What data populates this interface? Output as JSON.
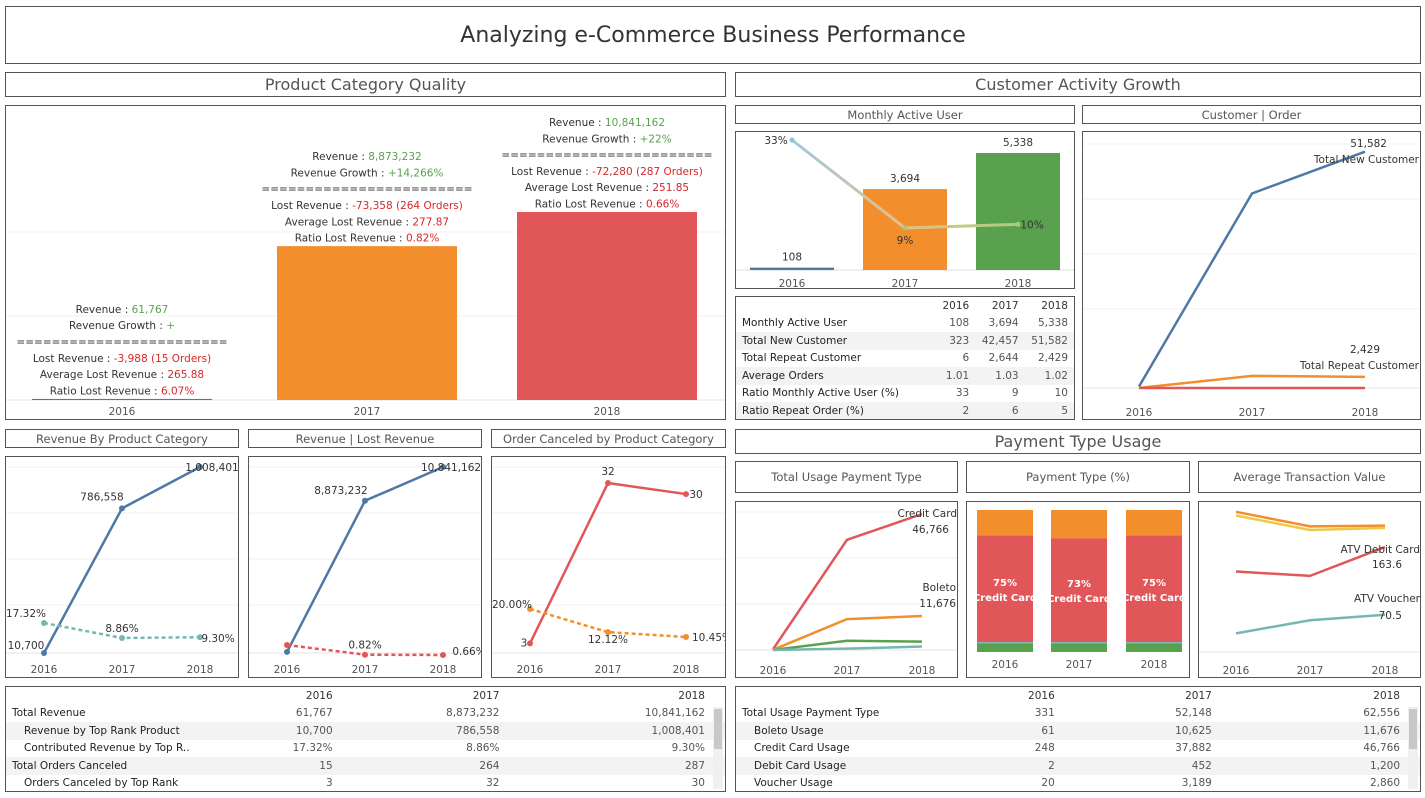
{
  "page_title": "Analyzing e-Commerce Business Performance",
  "sections": {
    "product": "Product Category Quality",
    "customer": "Customer Activity Growth",
    "payment": "Payment Type Usage"
  },
  "subtitles": {
    "mau": "Monthly Active User",
    "cust_order": "Customer | Order",
    "rev_cat": "Revenue By Product Category",
    "rev_lost": "Revenue | Lost Revenue",
    "cancel_cat": "Order Canceled by Product Category",
    "total_usage": "Total Usage Payment Type",
    "pay_pct": "Payment Type (%)",
    "atv": "Average Transaction Value"
  },
  "colors": {
    "blue": "#4e79a7",
    "orange": "#f28e2b",
    "red": "#e15759",
    "green": "#59a14f",
    "teal": "#76b7b2",
    "yellow": "#edc948",
    "light_blue": "#8cc5e0",
    "pos": "#59a14f",
    "neg": "#d62728"
  },
  "chart_data": [
    {
      "id": "product_quality",
      "type": "bar",
      "categories": [
        "2016",
        "2017",
        "2018"
      ],
      "values": [
        61767,
        8873232,
        10841162
      ],
      "bar_colors": [
        "#4e79a7",
        "#f28e2b",
        "#e15759"
      ],
      "annotations": [
        {
          "revenue": "61,767",
          "growth": "+",
          "sep": "========================",
          "lost": "-3,988 (15 Orders)",
          "avg_lost": "265.88",
          "ratio": "6.07%"
        },
        {
          "revenue": "8,873,232",
          "growth": "+14,266%",
          "sep": "========================",
          "lost": "-73,358 (264 Orders)",
          "avg_lost": "277.87",
          "ratio": "0.82%"
        },
        {
          "revenue": "10,841,162",
          "growth": "+22%",
          "sep": "========================",
          "lost": "-72,280 (287 Orders)",
          "avg_lost": "251.85",
          "ratio": "0.66%"
        }
      ],
      "labels": {
        "revenue": "Revenue : ",
        "growth": "Revenue Growth : ",
        "lost": "Lost Revenue : ",
        "avg_lost": "Average Lost Revenue : ",
        "ratio": "Ratio Lost Revenue : "
      }
    },
    {
      "id": "mau",
      "type": "bar",
      "categories": [
        "2016",
        "2017",
        "2018"
      ],
      "values": [
        108,
        3694,
        5338
      ],
      "labels": [
        "108",
        "3,694",
        "5,338"
      ],
      "bar_colors": [
        "#4e79a7",
        "#f28e2b",
        "#59a14f"
      ],
      "ratio_series": {
        "values": [
          33,
          9,
          10
        ],
        "labels": [
          "33%",
          "9%",
          "10%"
        ]
      }
    },
    {
      "id": "customer_order",
      "type": "line",
      "x": [
        "2016",
        "2017",
        "2018"
      ],
      "series": [
        {
          "name": "Total New Customer",
          "values": [
            323,
            42457,
            51582
          ],
          "color": "#4e79a7",
          "end_label": "51,582"
        },
        {
          "name": "Total Repeat Customer",
          "values": [
            6,
            2644,
            2429
          ],
          "color": "#f28e2b",
          "end_label": "2,429"
        },
        {
          "values": [
            1.01,
            1.03,
            1.02
          ],
          "color": "#e15759"
        }
      ]
    },
    {
      "id": "rev_by_category",
      "type": "line",
      "x": [
        "2016",
        "2017",
        "2018"
      ],
      "series": [
        {
          "values": [
            10700,
            786558,
            1008401
          ],
          "labels": [
            "10,700",
            "786,558",
            "1,008,401"
          ],
          "color": "#4e79a7"
        },
        {
          "values": [
            17.32,
            8.86,
            9.3
          ],
          "labels": [
            "17.32%",
            "8.86%",
            "9.30%"
          ],
          "color": "#76b7b2",
          "dashed": true
        }
      ]
    },
    {
      "id": "rev_lost",
      "type": "line",
      "x": [
        "2016",
        "2017",
        "2018"
      ],
      "series": [
        {
          "values": [
            61767,
            8873232,
            10841162
          ],
          "labels": [
            "",
            "8,873,232",
            "10,841,162"
          ],
          "color": "#4e79a7"
        },
        {
          "values": [
            6.07,
            0.82,
            0.66
          ],
          "labels": [
            "",
            "0.82%",
            "0.66%"
          ],
          "color": "#e15759",
          "dashed": true
        }
      ]
    },
    {
      "id": "cancel_by_category",
      "type": "line",
      "x": [
        "2016",
        "2017",
        "2018"
      ],
      "series": [
        {
          "values": [
            3,
            32,
            30
          ],
          "labels": [
            "3",
            "32",
            "30"
          ],
          "color": "#e15759"
        },
        {
          "values": [
            20.0,
            12.12,
            10.45
          ],
          "labels": [
            "20.00%",
            "12.12%",
            "10.45%"
          ],
          "color": "#f28e2b",
          "dashed": true
        }
      ]
    },
    {
      "id": "total_usage",
      "type": "line",
      "x": [
        "2016",
        "2017",
        "2018"
      ],
      "series": [
        {
          "name": "Credit Card",
          "values": [
            248,
            37882,
            46766
          ],
          "color": "#e15759",
          "end_label": "46,766"
        },
        {
          "name": "Boleto",
          "values": [
            61,
            10625,
            11676
          ],
          "color": "#f28e2b",
          "end_label": "11,676"
        },
        {
          "values": [
            20,
            3189,
            2860
          ],
          "color": "#59a14f"
        },
        {
          "values": [
            2,
            452,
            1200
          ],
          "color": "#76b7b2"
        }
      ]
    },
    {
      "id": "payment_pct",
      "type": "bar",
      "categories": [
        "2016",
        "2017",
        "2018"
      ],
      "stack": [
        {
          "name": "Boleto",
          "values": [
            18,
            20,
            18
          ],
          "color": "#f28e2b"
        },
        {
          "name": "Credit Card",
          "values": [
            75,
            73,
            75
          ],
          "color": "#e15759",
          "labels": [
            "75%",
            "73%",
            "75%"
          ]
        },
        {
          "values": [
            1,
            1,
            1
          ],
          "color": "#76b7b2"
        },
        {
          "values": [
            6,
            6,
            6
          ],
          "color": "#59a14f"
        }
      ]
    },
    {
      "id": "atv",
      "type": "line",
      "x": [
        "2016",
        "2017",
        "2018"
      ],
      "series": [
        {
          "values": [
            212,
            192,
            193
          ],
          "color": "#f28e2b"
        },
        {
          "values": [
            207,
            187,
            190
          ],
          "color": "#edc948"
        },
        {
          "name": "ATV Debit Card",
          "values": [
            130,
            124,
            163.6
          ],
          "color": "#e15759",
          "end_label": "163.6"
        },
        {
          "name": "ATV Voucher",
          "values": [
            45,
            63,
            70.5
          ],
          "color": "#76b7b2",
          "end_label": "70.5"
        }
      ]
    }
  ],
  "customer_table": {
    "headers": [
      "2016",
      "2017",
      "2018"
    ],
    "rows": [
      {
        "label": "Monthly Active User",
        "values": [
          "108",
          "3,694",
          "5,338"
        ]
      },
      {
        "label": "Total New Customer",
        "values": [
          "323",
          "42,457",
          "51,582"
        ]
      },
      {
        "label": "Total Repeat Customer",
        "values": [
          "6",
          "2,644",
          "2,429"
        ]
      },
      {
        "label": "Average Orders",
        "values": [
          "1.01",
          "1.03",
          "1.02"
        ]
      },
      {
        "label": "Ratio Monthly Active User (%)",
        "values": [
          "33",
          "9",
          "10"
        ]
      },
      {
        "label": "Ratio Repeat Order (%)",
        "values": [
          "2",
          "6",
          "5"
        ]
      }
    ]
  },
  "revenue_table": {
    "headers": [
      "2016",
      "2017",
      "2018"
    ],
    "rows": [
      {
        "label": "Total Revenue",
        "values": [
          "61,767",
          "8,873,232",
          "10,841,162"
        ]
      },
      {
        "label": "Revenue by Top Rank Product",
        "values": [
          "10,700",
          "786,558",
          "1,008,401"
        ]
      },
      {
        "label": "Contributed Revenue by Top R..",
        "values": [
          "17.32%",
          "8.86%",
          "9.30%"
        ]
      },
      {
        "label": "Total Orders Canceled",
        "values": [
          "15",
          "264",
          "287"
        ]
      },
      {
        "label": "Orders Canceled by Top Rank",
        "values": [
          "3",
          "32",
          "30"
        ]
      }
    ]
  },
  "payment_table": {
    "headers": [
      "2016",
      "2017",
      "2018"
    ],
    "rows": [
      {
        "label": "Total Usage Payment Type",
        "values": [
          "331",
          "52,148",
          "62,556"
        ]
      },
      {
        "label": "Boleto Usage",
        "values": [
          "61",
          "10,625",
          "11,676"
        ]
      },
      {
        "label": "Credit Card Usage",
        "values": [
          "248",
          "37,882",
          "46,766"
        ]
      },
      {
        "label": "Debit Card Usage",
        "values": [
          "2",
          "452",
          "1,200"
        ]
      },
      {
        "label": "Voucher Usage",
        "values": [
          "20",
          "3,189",
          "2,860"
        ]
      }
    ]
  }
}
